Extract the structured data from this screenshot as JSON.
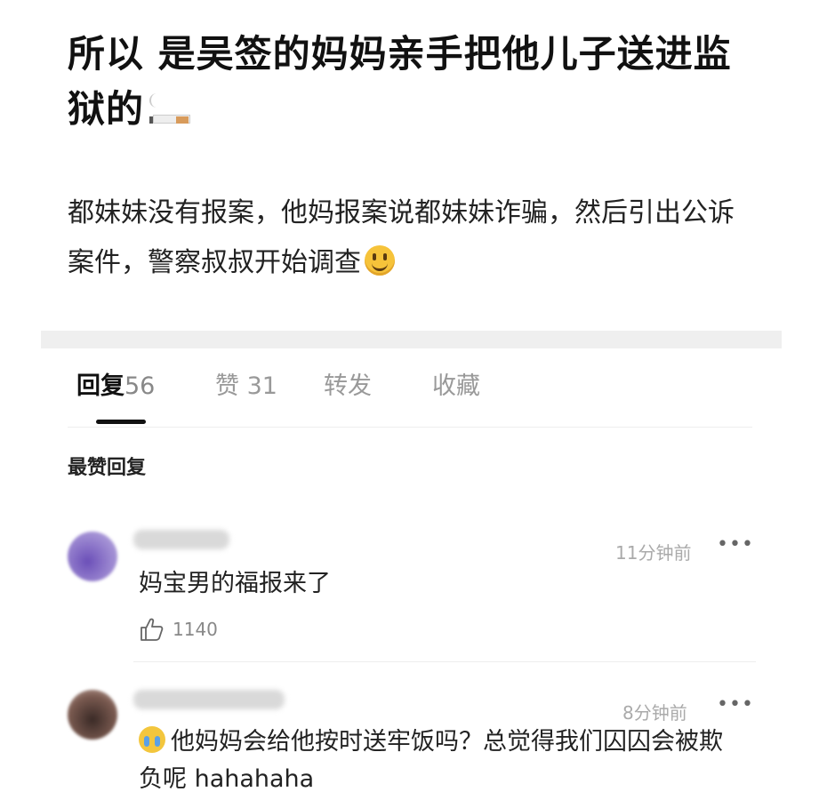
{
  "post": {
    "title": "所以 是吴签的妈妈亲手把他儿子送进监狱的",
    "body": "都妹妹没有报案，他妈报案说都妹妹诈骗，然后引出公诉案件，警察叔叔开始调查"
  },
  "tabs": [
    {
      "label": "回复",
      "count": "56",
      "active": true
    },
    {
      "label": "赞",
      "count": "31",
      "active": false
    },
    {
      "label": "转发",
      "count": "",
      "active": false
    },
    {
      "label": "收藏",
      "count": "",
      "active": false
    }
  ],
  "section_label": "最赞回复",
  "comments": [
    {
      "time": "11分钟前",
      "more": "•••",
      "text": "妈宝男的福报来了",
      "likes": "1140"
    },
    {
      "time": "8分钟前",
      "more": "•••",
      "text": "他妈妈会给他按时送牢饭吗？总觉得我们囚囚会被欺负呢 hahahaha"
    }
  ],
  "icons": {
    "title_emoji": "cigarette-icon",
    "body_emoji": "smiling-face-icon",
    "comment2_emoji": "crying-face-icon",
    "like": "thumbs-up-icon"
  },
  "colors": {
    "text": "#1a1a1a",
    "muted": "#999999",
    "band": "#efefef"
  }
}
